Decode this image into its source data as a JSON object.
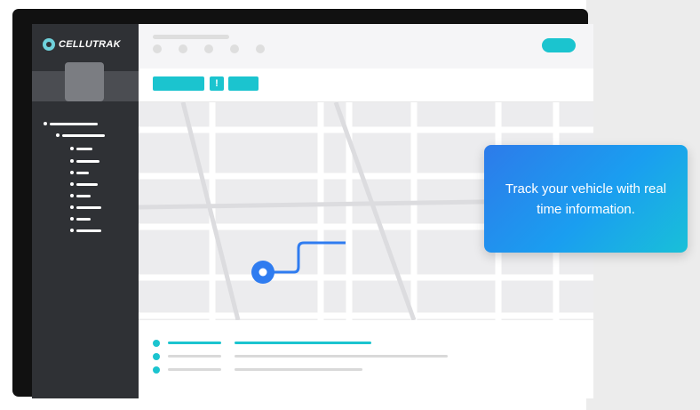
{
  "app": {
    "logo_text": "CELLUTRAK"
  },
  "colors": {
    "accent": "#1bc4cf",
    "sidebar": "#2f3135",
    "route": "#2f7cf0",
    "tooltip_start": "#2d7bea",
    "tooltip_end": "#19c0d8"
  },
  "toolbar": {
    "icon_label": "!"
  },
  "tooltip": {
    "text": "Track your vehicle with real time information."
  },
  "icons": [
    "logo-mark-icon",
    "location-marker-icon"
  ]
}
